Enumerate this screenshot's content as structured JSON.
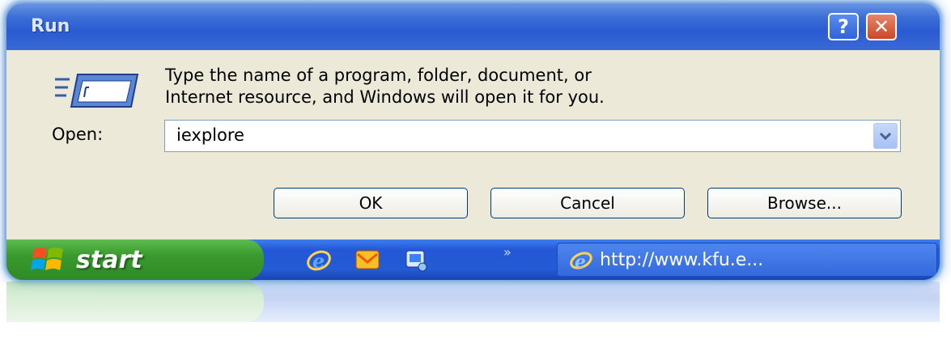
{
  "window": {
    "title": "Run",
    "help_label": "?",
    "close_label": "✕"
  },
  "dialog": {
    "description_line1": "Type the name of a program, folder, document, or",
    "description_line2": "Internet resource, and Windows will open it for you.",
    "open_label": "Open:",
    "open_value": "iexplore",
    "ok_label": "OK",
    "cancel_label": "Cancel",
    "browse_label": "Browse..."
  },
  "taskbar": {
    "start_label": "start",
    "chevron": "»",
    "task_label": "http://www.kfu.e...",
    "quick_launch_icons": [
      "internet-explorer-icon",
      "outlook-express-icon",
      "show-desktop-icon"
    ]
  },
  "colors": {
    "titlebar": "#2a5bd0",
    "dialog_bg": "#ece9d8",
    "taskbar": "#245ad4",
    "start_button": "#3a9a2e"
  }
}
